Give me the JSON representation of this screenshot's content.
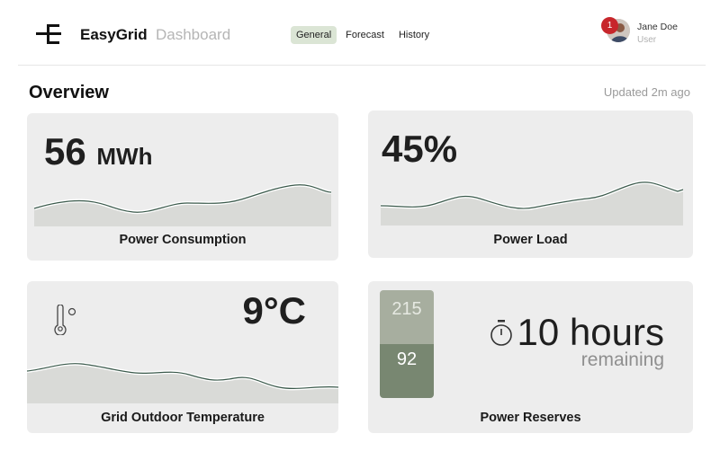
{
  "header": {
    "brand": "EasyGrid",
    "section": "Dashboard",
    "tabs": [
      {
        "label": "General",
        "active": true
      },
      {
        "label": "Forecast",
        "active": false
      },
      {
        "label": "History",
        "active": false
      }
    ],
    "user": {
      "name": "Jane Doe",
      "role": "User",
      "notifications": "1"
    }
  },
  "overview": {
    "title": "Overview",
    "updated": "Updated 2m ago"
  },
  "cards": {
    "consumption": {
      "value": "56",
      "unit": "MWh",
      "title": "Power Consumption"
    },
    "load": {
      "value": "45%",
      "title": "Power Load"
    },
    "temperature": {
      "value": "9°C",
      "title": "Grid Outdoor Temperature"
    },
    "reserves": {
      "top_value": "215",
      "bottom_value": "92",
      "hours": "10 hours",
      "remaining": "remaining",
      "title": "Power Reserves"
    }
  },
  "colors": {
    "accent_tab": "#dbe5d5",
    "gauge_light": "#a7ae9f",
    "gauge_dark": "#788771",
    "badge": "#c7262b",
    "card_bg": "#ededed",
    "wave_line": "#3b5a4c"
  },
  "icons": {
    "logo": "easygrid-logo",
    "temperature": "thermometer-icon",
    "timer": "stopwatch-icon"
  }
}
